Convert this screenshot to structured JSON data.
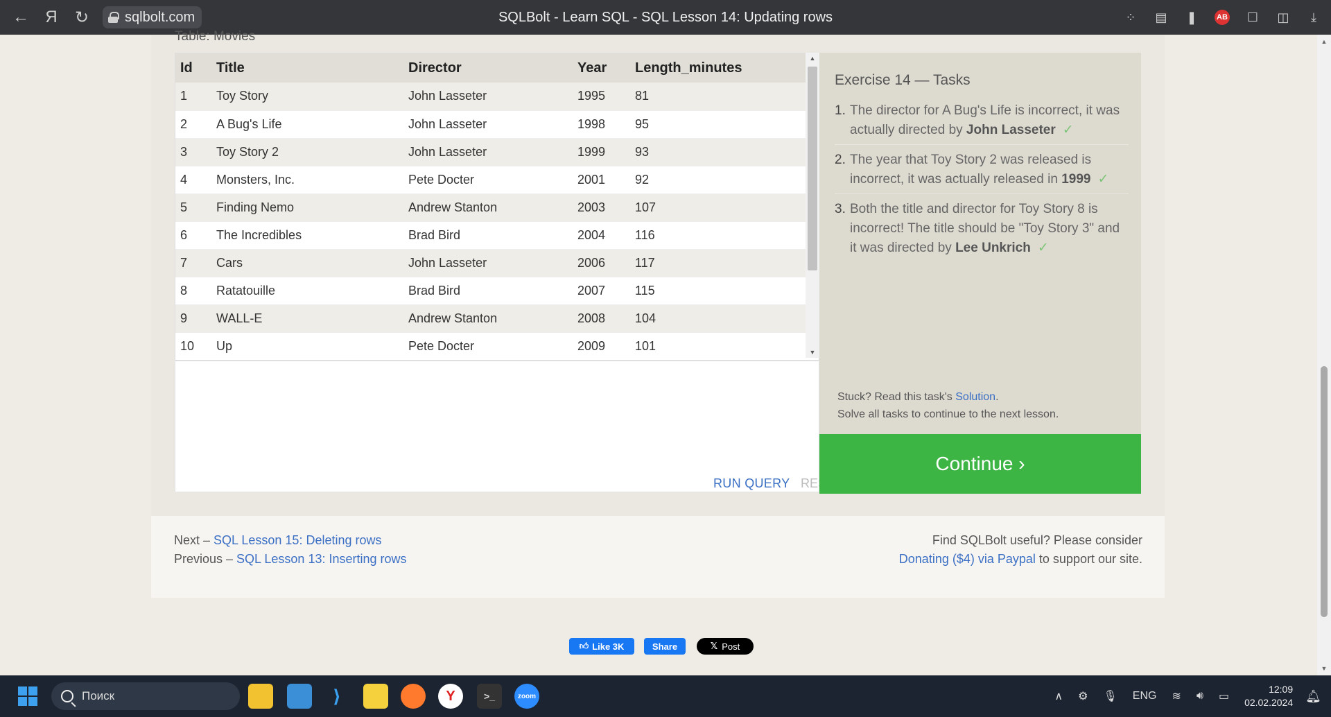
{
  "browser": {
    "url": "sqlbolt.com",
    "title": "SQLBolt - Learn SQL - SQL Lesson 14: Updating rows"
  },
  "table": {
    "caption": "Table: Movies",
    "headers": [
      "Id",
      "Title",
      "Director",
      "Year",
      "Length_minutes"
    ],
    "rows": [
      [
        "1",
        "Toy Story",
        "John Lasseter",
        "1995",
        "81"
      ],
      [
        "2",
        "A Bug's Life",
        "John Lasseter",
        "1998",
        "95"
      ],
      [
        "3",
        "Toy Story 2",
        "John Lasseter",
        "1999",
        "93"
      ],
      [
        "4",
        "Monsters, Inc.",
        "Pete Docter",
        "2001",
        "92"
      ],
      [
        "5",
        "Finding Nemo",
        "Andrew Stanton",
        "2003",
        "107"
      ],
      [
        "6",
        "The Incredibles",
        "Brad Bird",
        "2004",
        "116"
      ],
      [
        "7",
        "Cars",
        "John Lasseter",
        "2006",
        "117"
      ],
      [
        "8",
        "Ratatouille",
        "Brad Bird",
        "2007",
        "115"
      ],
      [
        "9",
        "WALL-E",
        "Andrew Stanton",
        "2008",
        "104"
      ],
      [
        "10",
        "Up",
        "Pete Docter",
        "2009",
        "101"
      ]
    ]
  },
  "editor": {
    "run_label": "RUN QUERY",
    "reset_label": "RESET"
  },
  "tasks": {
    "heading": "Exercise 14 — Tasks",
    "items": [
      {
        "num": "1.",
        "text": "The director for A Bug's Life is incorrect, it was actually directed by ",
        "bold": "John Lasseter",
        "check": "✓"
      },
      {
        "num": "2.",
        "text": "The year that Toy Story 2 was released is incorrect, it was actually released in ",
        "bold": "1999",
        "check": "✓"
      },
      {
        "num": "3.",
        "text": "Both the title and director for Toy Story 8 is incorrect! The title should be \"Toy Story 3\" and it was directed by ",
        "bold": "Lee Unkrich",
        "check": "✓"
      }
    ],
    "stuck_prefix": "Stuck? Read this task's ",
    "solution_link": "Solution",
    "stuck_suffix": ".",
    "continue_hint": "Solve all tasks to continue to the next lesson.",
    "continue_label": "Continue ›"
  },
  "footer": {
    "next_prefix": "Next – ",
    "next_link": "SQL Lesson 15: Deleting rows",
    "prev_prefix": "Previous – ",
    "prev_link": "SQL Lesson 13: Inserting rows",
    "support_line1": "Find SQLBolt useful? Please consider",
    "donate_link": "Donating ($4) via Paypal",
    "support_suffix": " to support our site."
  },
  "social": {
    "like": "Like 3K",
    "share": "Share",
    "post": "Post"
  },
  "taskbar": {
    "search_placeholder": "Поиск",
    "lang": "ENG",
    "time": "12:09",
    "date": "02.02.2024"
  }
}
